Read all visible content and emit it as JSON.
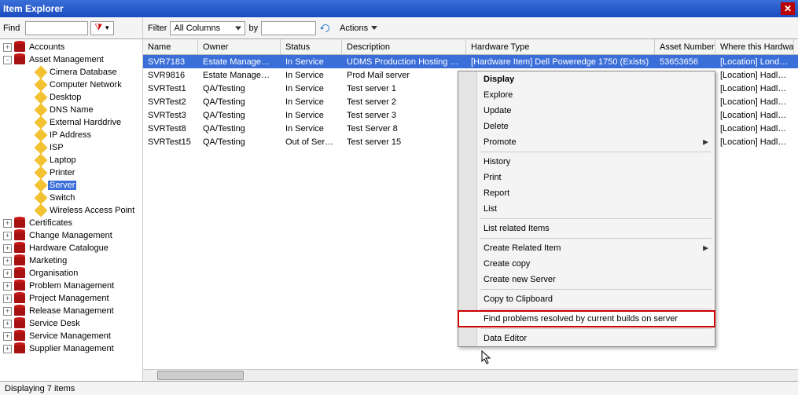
{
  "title": "Item Explorer",
  "find": {
    "label": "Find",
    "value": "",
    "filter_icon": "filter-funnel-icon"
  },
  "filter": {
    "label": "Filter",
    "column": "All Columns",
    "by": "by",
    "value": "",
    "actions_label": "Actions"
  },
  "tree": {
    "root": [
      {
        "label": "Accounts",
        "exp": "+",
        "icon": "db"
      },
      {
        "label": "Asset Management",
        "exp": "-",
        "icon": "db",
        "children": [
          {
            "label": "Cimera Database",
            "icon": "y"
          },
          {
            "label": "Computer Network",
            "icon": "y"
          },
          {
            "label": "Desktop",
            "icon": "y"
          },
          {
            "label": "DNS Name",
            "icon": "y"
          },
          {
            "label": "External Harddrive",
            "icon": "y"
          },
          {
            "label": "IP Address",
            "icon": "y"
          },
          {
            "label": "ISP",
            "icon": "y"
          },
          {
            "label": "Laptop",
            "icon": "y"
          },
          {
            "label": "Printer",
            "icon": "y"
          },
          {
            "label": "Server",
            "icon": "y",
            "selected": true
          },
          {
            "label": "Switch",
            "icon": "y"
          },
          {
            "label": "Wireless Access Point",
            "icon": "y"
          }
        ]
      },
      {
        "label": "Certificates",
        "exp": "+",
        "icon": "db"
      },
      {
        "label": "Change Management",
        "exp": "+",
        "icon": "db"
      },
      {
        "label": "Hardware Catalogue",
        "exp": "+",
        "icon": "db"
      },
      {
        "label": "Marketing",
        "exp": "+",
        "icon": "db"
      },
      {
        "label": "Organisation",
        "exp": "+",
        "icon": "db"
      },
      {
        "label": "Problem Management",
        "exp": "+",
        "icon": "db"
      },
      {
        "label": "Project Management",
        "exp": "+",
        "icon": "db"
      },
      {
        "label": "Release Management",
        "exp": "+",
        "icon": "db"
      },
      {
        "label": "Service Desk",
        "exp": "+",
        "icon": "db"
      },
      {
        "label": "Service Management",
        "exp": "+",
        "icon": "db"
      },
      {
        "label": "Supplier Management",
        "exp": "+",
        "icon": "db"
      }
    ]
  },
  "grid": {
    "columns": [
      "Name",
      "Owner",
      "Status",
      "Description",
      "Hardware Type",
      "Asset Number",
      "Where this Hardware"
    ],
    "rows": [
      {
        "name": "SVR7183",
        "owner": "Estate Management",
        "status": "In Service",
        "desc": "UDMS Production Hosting box",
        "hw": "[Hardware Item] Dell Poweredge 1750 (Exists)",
        "asset": "53653656",
        "where": "[Location] London S",
        "selected": true
      },
      {
        "name": "SVR9816",
        "owner": "Estate Management",
        "status": "In Service",
        "desc": "Prod Mail server",
        "hw": "",
        "asset": "",
        "where": "[Location] Hadlow D"
      },
      {
        "name": "SVRTest1",
        "owner": "QA/Testing",
        "status": "In Service",
        "desc": "Test server 1",
        "hw": "",
        "asset": "",
        "where": "[Location] Hadlow D"
      },
      {
        "name": "SVRTest2",
        "owner": "QA/Testing",
        "status": "In Service",
        "desc": "Test server 2",
        "hw": "",
        "asset": "",
        "where": "[Location] Hadlow D"
      },
      {
        "name": "SVRTest3",
        "owner": "QA/Testing",
        "status": "In Service",
        "desc": "Test server 3",
        "hw": "",
        "asset": "",
        "where": "[Location] Hadlow D"
      },
      {
        "name": "SVRTest8",
        "owner": "QA/Testing",
        "status": "In Service",
        "desc": "Test Server 8",
        "hw": "",
        "asset": "",
        "where": "[Location] Hadlow D"
      },
      {
        "name": "SVRTest15",
        "owner": "QA/Testing",
        "status": "Out of Service",
        "desc": "Test server 15",
        "hw": "",
        "asset": "",
        "where": "[Location] Hadlow D"
      }
    ]
  },
  "context_menu": [
    {
      "label": "Display",
      "bold": true
    },
    {
      "label": "Explore"
    },
    {
      "label": "Update"
    },
    {
      "label": "Delete"
    },
    {
      "label": "Promote",
      "submenu": true
    },
    {
      "sep": true
    },
    {
      "label": "History"
    },
    {
      "label": "Print"
    },
    {
      "label": "Report"
    },
    {
      "label": "List"
    },
    {
      "sep": true
    },
    {
      "label": "List related Items"
    },
    {
      "sep": true
    },
    {
      "label": "Create Related Item",
      "submenu": true
    },
    {
      "label": "Create copy"
    },
    {
      "label": "Create new Server"
    },
    {
      "sep": true
    },
    {
      "label": "Copy to Clipboard"
    },
    {
      "sep": true
    },
    {
      "label": "Find problems resolved by current builds on server",
      "highlight": true
    },
    {
      "sep": true
    },
    {
      "label": "Data Editor"
    }
  ],
  "statusbar": {
    "text": "Displaying 7 items"
  }
}
